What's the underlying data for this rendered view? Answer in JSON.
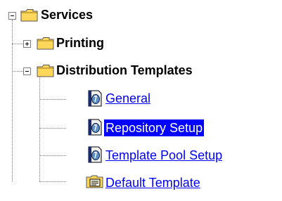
{
  "tree": {
    "root": {
      "label": "Services",
      "expanded": true,
      "icon": "folder-icon"
    },
    "printing": {
      "label": "Printing",
      "expanded": false,
      "icon": "folder-icon"
    },
    "distribution": {
      "label": "Distribution Templates",
      "expanded": true,
      "icon": "folder-icon"
    },
    "items": [
      {
        "label": "General",
        "icon": "document-icon",
        "selected": false
      },
      {
        "label": "Repository Setup",
        "icon": "document-icon",
        "selected": true
      },
      {
        "label": "Template Pool Setup",
        "icon": "document-icon",
        "selected": false
      },
      {
        "label": "Default Template",
        "icon": "template-icon",
        "selected": false
      }
    ]
  },
  "colors": {
    "link": "#0000ff",
    "selection_bg": "#0000ff",
    "selection_text": "#ffffff",
    "folder": "#ffd75a",
    "tree_lines": "#808080"
  }
}
